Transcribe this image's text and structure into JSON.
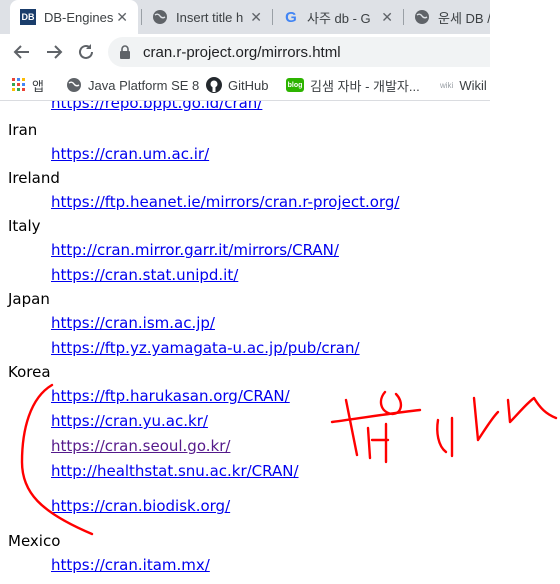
{
  "tabs": [
    {
      "title": "DB-Engines",
      "favicon": "db-engines-favicon",
      "favicon_text": "DB"
    },
    {
      "title": "Insert title h",
      "favicon": "globe-icon"
    },
    {
      "title": "사주 db - G",
      "favicon": "google-icon"
    },
    {
      "title": "운세 DB /",
      "favicon": "globe-icon"
    }
  ],
  "address_bar": {
    "url": "cran.r-project.org/mirrors.html"
  },
  "bookmarks": [
    {
      "label": "앱",
      "icon": "apps-grid-icon"
    },
    {
      "label": "Java Platform SE 8",
      "icon": "globe-icon"
    },
    {
      "label": "GitHub",
      "icon": "github-icon"
    },
    {
      "label": "김샘 자바 - 개발자...",
      "icon": "blog-icon",
      "icon_text": "blog"
    },
    {
      "label": "Wikil",
      "icon": "wiki-icon",
      "icon_text": "wiki"
    }
  ],
  "mirrors": {
    "top_partial_link": "https://repo.bppt.go.id/cran/",
    "iran": {
      "name": "Iran",
      "links": [
        "https://cran.um.ac.ir/"
      ]
    },
    "ireland": {
      "name": "Ireland",
      "links": [
        "https://ftp.heanet.ie/mirrors/cran.r-project.org/"
      ]
    },
    "italy": {
      "name": "Italy",
      "links": [
        "http://cran.mirror.garr.it/mirrors/CRAN/",
        "https://cran.stat.unipd.it/"
      ]
    },
    "japan": {
      "name": "Japan",
      "links": [
        "https://cran.ism.ac.jp/",
        "https://ftp.yz.yamagata-u.ac.jp/pub/cran/"
      ]
    },
    "korea": {
      "name": "Korea",
      "links": [
        "https://ftp.harukasan.org/CRAN/",
        "https://cran.yu.ac.kr/",
        "https://cran.seoul.go.kr/",
        "http://healthstat.snu.ac.kr/CRAN/",
        "https://cran.biodisk.org/"
      ]
    },
    "mexico": {
      "name": "Mexico",
      "links": [
        "https://cran.itam.mx/"
      ]
    }
  },
  "colors": {
    "link": "#0000ee",
    "visited_link": "#551a8b",
    "annotation": "#ff0000"
  }
}
